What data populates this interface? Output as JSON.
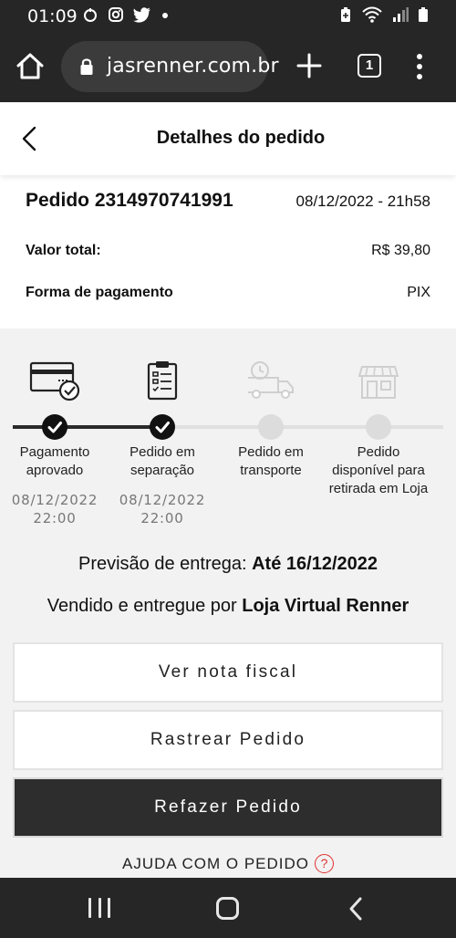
{
  "status_bar": {
    "time": "01:09",
    "left_icons": [
      "nfc-icon",
      "instagram-icon",
      "twitter-icon",
      "dot-icon"
    ],
    "right_icons": [
      "battery-saver-icon",
      "wifi-icon",
      "signal-icon",
      "battery-icon"
    ]
  },
  "browser": {
    "url": "jasrenner.com.br",
    "tab_count": "1"
  },
  "header": {
    "title": "Detalhes do pedido"
  },
  "order": {
    "number_label": "Pedido 2314970741991",
    "date": "08/12/2022 - 21h58",
    "total_label": "Valor total:",
    "total_value": "R$ 39,80",
    "payment_label": "Forma de pagamento",
    "payment_value": "PIX"
  },
  "tracker": {
    "steps": [
      {
        "label_line1": "Pagamento",
        "label_line2": "aprovado",
        "label_line3": "",
        "date_line1": "08/12/2022",
        "date_line2": "22:00",
        "done": true
      },
      {
        "label_line1": "Pedido em",
        "label_line2": "separação",
        "label_line3": "",
        "date_line1": "08/12/2022",
        "date_line2": "22:00",
        "done": true
      },
      {
        "label_line1": "Pedido em",
        "label_line2": "transporte",
        "label_line3": "",
        "date_line1": "",
        "date_line2": "",
        "done": false
      },
      {
        "label_line1": "Pedido",
        "label_line2": "disponível para",
        "label_line3": "retirada em Loja",
        "date_line1": "",
        "date_line2": "",
        "done": false
      }
    ],
    "colors": {
      "done": "#111111",
      "pending": "#dcdcdc"
    }
  },
  "delivery": {
    "prefix": "Previsão de entrega: ",
    "value": "Até 16/12/2022"
  },
  "seller": {
    "prefix": "Vendido e entregue por ",
    "value": "Loja Virtual Renner"
  },
  "buttons": {
    "invoice": "Ver nota fiscal",
    "track": "Rastrear Pedido",
    "reorder": "Refazer Pedido"
  },
  "help": {
    "label": "AJUDA COM O PEDIDO",
    "icon_glyph": "?"
  }
}
